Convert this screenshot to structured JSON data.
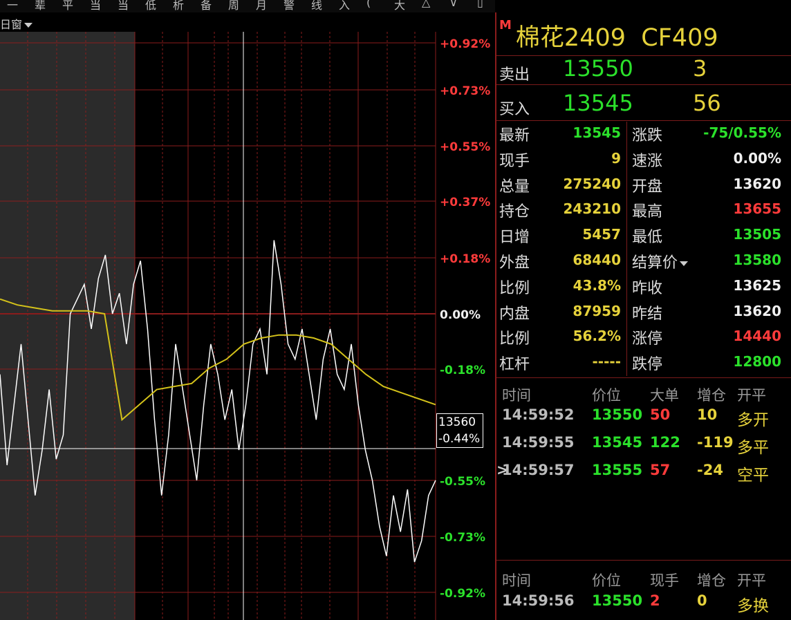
{
  "topbar": {
    "glyphs": [
      "一",
      "辈",
      "平",
      "当",
      "当",
      "低",
      "析",
      "备",
      "周",
      "月",
      "警",
      "线",
      "入",
      "(",
      "大",
      "△",
      "∨",
      "▯"
    ]
  },
  "subbar": {
    "label": "日窗"
  },
  "chart": {
    "right_axis_labels": [
      "+0.92%",
      "+0.73%",
      "+0.55%",
      "+0.37%",
      "+0.18%",
      "0.00%",
      "-0.18%",
      "-0.55%",
      "-0.73%",
      "-0.92%"
    ],
    "crosshair_price": "13560",
    "crosshair_pct": "-0.44%",
    "colors": {
      "price_line": "#ffffff",
      "avg_line": "#d4c21a",
      "grid": "#8b1c1c",
      "session_bg": "#2b2b2b"
    }
  },
  "chart_data": {
    "type": "line",
    "title": "",
    "xlabel": "",
    "ylabel": "",
    "ylim_pct": [
      -0.92,
      0.92
    ],
    "y_tick_labels": [
      "+0.92%",
      "+0.73%",
      "+0.55%",
      "+0.37%",
      "+0.18%",
      "0.00%",
      "-0.18%",
      "-0.55%",
      "-0.73%",
      "-0.92%"
    ],
    "reference_close": 13625,
    "series": [
      {
        "values_pct": [
          -0.2,
          -0.5,
          -0.3,
          -0.1,
          -0.35,
          -0.6,
          -0.45,
          -0.25,
          -0.48,
          -0.4,
          0.0,
          0.05,
          0.1,
          -0.05,
          0.12,
          0.2,
          0.0,
          0.07,
          -0.1,
          0.1,
          0.18,
          -0.05,
          -0.35,
          -0.6,
          -0.4,
          -0.1,
          -0.25,
          -0.4,
          -0.55,
          -0.3,
          -0.1,
          -0.2,
          -0.35,
          -0.25,
          -0.45,
          -0.3,
          -0.1,
          -0.05,
          -0.2,
          0.25,
          0.1,
          -0.1,
          -0.15,
          -0.05,
          -0.2,
          -0.35,
          -0.15,
          -0.05,
          -0.2,
          -0.25,
          -0.1,
          -0.3,
          -0.45,
          -0.55,
          -0.7,
          -0.8,
          -0.6,
          -0.72,
          -0.58,
          -0.82,
          -0.75,
          -0.6,
          -0.55
        ]
      },
      {
        "values_pct": [
          0.05,
          0.03,
          0.02,
          0.01,
          0.01,
          0.01,
          0.0,
          -0.35,
          -0.3,
          -0.25,
          -0.24,
          -0.23,
          -0.18,
          -0.15,
          -0.1,
          -0.08,
          -0.07,
          -0.07,
          -0.08,
          -0.1,
          -0.15,
          -0.2,
          -0.24,
          -0.26,
          -0.28,
          -0.3
        ]
      }
    ]
  },
  "panel": {
    "flag": "M",
    "name": "棉花2409",
    "code": "CF409",
    "ask_label": "卖出",
    "ask_price": "13550",
    "ask_vol": "3",
    "bid_label": "买入",
    "bid_price": "13545",
    "bid_vol": "56",
    "stats_left": [
      {
        "k": "最新",
        "v": "13545",
        "c": "green"
      },
      {
        "k": "现手",
        "v": "9",
        "c": "yellow"
      },
      {
        "k": "总量",
        "v": "275240",
        "c": "yellow"
      },
      {
        "k": "持仓",
        "v": "243210",
        "c": "yellow"
      },
      {
        "k": "日增",
        "v": "5457",
        "c": "yellow"
      },
      {
        "k": "外盘",
        "v": "68440",
        "c": "yellow"
      },
      {
        "k": "比例",
        "v": "43.8%",
        "c": "yellow"
      },
      {
        "k": "内盘",
        "v": "87959",
        "c": "yellow"
      },
      {
        "k": "比例",
        "v": "56.2%",
        "c": "yellow"
      },
      {
        "k": "杠杆",
        "v": "-----",
        "c": "yellow"
      }
    ],
    "stats_right": [
      {
        "k": "涨跌",
        "v": "-75/0.55%",
        "c": "green"
      },
      {
        "k": "速涨",
        "v": "0.00%",
        "c": "white"
      },
      {
        "k": "开盘",
        "v": "13620",
        "c": "white"
      },
      {
        "k": "最高",
        "v": "13655",
        "c": "red"
      },
      {
        "k": "最低",
        "v": "13505",
        "c": "green"
      },
      {
        "k": "结算价",
        "v": "13580",
        "c": "green"
      },
      {
        "k": "昨收",
        "v": "13625",
        "c": "white"
      },
      {
        "k": "昨结",
        "v": "13620",
        "c": "white"
      },
      {
        "k": "涨停",
        "v": "14440",
        "c": "red"
      },
      {
        "k": "跌停",
        "v": "12800",
        "c": "green"
      }
    ],
    "big_orders_header": [
      "时间",
      "价位",
      "大单",
      "增仓",
      "开平"
    ],
    "big_orders": [
      {
        "marker": "",
        "time": "14:59:52",
        "price": "13550",
        "qty": "50",
        "qty_c": "red",
        "chg": "10",
        "type": "多开",
        "type_c": "yellow"
      },
      {
        "marker": "",
        "time": "14:59:55",
        "price": "13545",
        "qty": "122",
        "qty_c": "green",
        "chg": "-119",
        "type": "多平",
        "type_c": "yellow"
      },
      {
        "marker": ">",
        "time": "14:59:57",
        "price": "13555",
        "qty": "57",
        "qty_c": "red",
        "chg": "-24",
        "type": "空平",
        "type_c": "yellow"
      }
    ],
    "ticks_header": [
      "时间",
      "价位",
      "现手",
      "增仓",
      "开平"
    ],
    "ticks": [
      {
        "time": "14:59:56",
        "price": "13550",
        "qty": "2",
        "qty_c": "red",
        "chg": "0",
        "type": "多换",
        "type_c": "yellow"
      }
    ]
  }
}
